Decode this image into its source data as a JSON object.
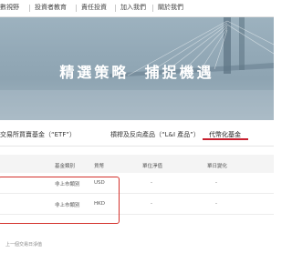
{
  "nav": {
    "items": [
      "數視野",
      "投資者教育",
      "責任投資",
      "加入我們",
      "關於我們"
    ]
  },
  "hero": {
    "title": "精選策略  捕捉機遇"
  },
  "tabs": [
    {
      "label": "交易所買賣基金（“ETF”）"
    },
    {
      "label": "槓桿及反向產品（“L&I 產品”）"
    },
    {
      "label": "代幣化基金"
    }
  ],
  "table": {
    "headers": [
      "基金類別",
      "貨幣",
      "單位淨值",
      "單日變化"
    ],
    "rows": [
      {
        "class": "非上市類別",
        "currency": "USD",
        "nav": "-",
        "change": "-"
      },
      {
        "class": "非上市類別",
        "currency": "HKD",
        "nav": "-",
        "change": "-"
      }
    ],
    "footnote": "上一個交易日淨值"
  },
  "colors": {
    "accent": "#c8202f",
    "highlight": "#d4302b"
  }
}
